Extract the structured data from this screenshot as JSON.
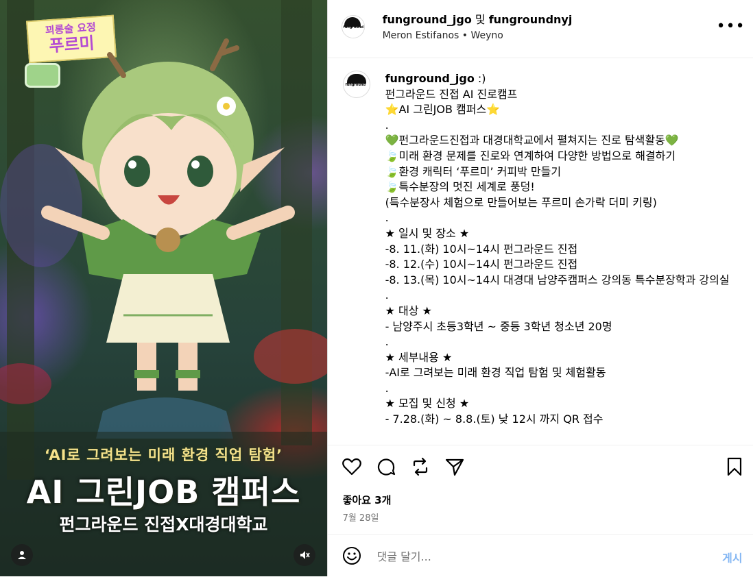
{
  "media": {
    "sign_line1": "꾀롱술 요정",
    "sign_line2": "푸르미",
    "overlay_subtitle": "‘AI로 그려보는 미래 환경 직업 탐험’",
    "overlay_title": "AI 그린JOB 캠퍼스",
    "overlay_org": "펀그라운드 진접X대경대학교"
  },
  "header": {
    "user1": "funground_jgo",
    "joiner": " 및 ",
    "user2": "fungroundnyj",
    "subtitle": "Meron Estifanos • Weyno",
    "more": "•••"
  },
  "caption": {
    "username": "funground_jgo",
    "text": " :)\n펀그라운드 진접 AI 진로캠프\n⭐AI 그린JOB 캠퍼스⭐\n.\n💚펀그라운드진접과 대경대학교에서 펼쳐지는 진로 탐색활동💚\n🍃미래 환경 문제를 진로와 연계하여 다양한 방법으로 해결하기\n🍃환경 캐릭터 ‘푸르미’ 커피박 만들기\n🍃특수분장의 멋진 세계로 풍덩!\n(특수분장사 체험으로 만들어보는 푸르미 손가락 더미 키링)\n.\n★ 일시 및 장소 ★\n-8. 11.(화) 10시~14시 펀그라운드 진접\n-8. 12.(수) 10시~14시 펀그라운드 진접\n-8. 13.(목) 10시~14시 대경대 남양주캠퍼스 강의동 특수분장학과 강의실\n.\n★ 대상 ★\n- 남양주시 초등3학년 ~ 중등 3학년 청소년 20명\n.\n★ 세부내용 ★\n-AI로 그려보는 미래 환경 직업 탐험 및 체험활동\n.\n★ 모집 및 신청 ★\n- 7.28.(화) ~ 8.8.(토) 낮 12시 까지 QR 접수"
  },
  "stats": {
    "likes": "좋아요 3개",
    "date": "7월 28일"
  },
  "comment": {
    "placeholder": "댓글 달기...",
    "post_label": "게시"
  },
  "avatar_text": "funground",
  "icons": [
    "heart-icon",
    "comment-icon",
    "repost-icon",
    "share-icon",
    "bookmark-icon",
    "emoji-icon",
    "user-tag-icon",
    "mute-icon"
  ]
}
